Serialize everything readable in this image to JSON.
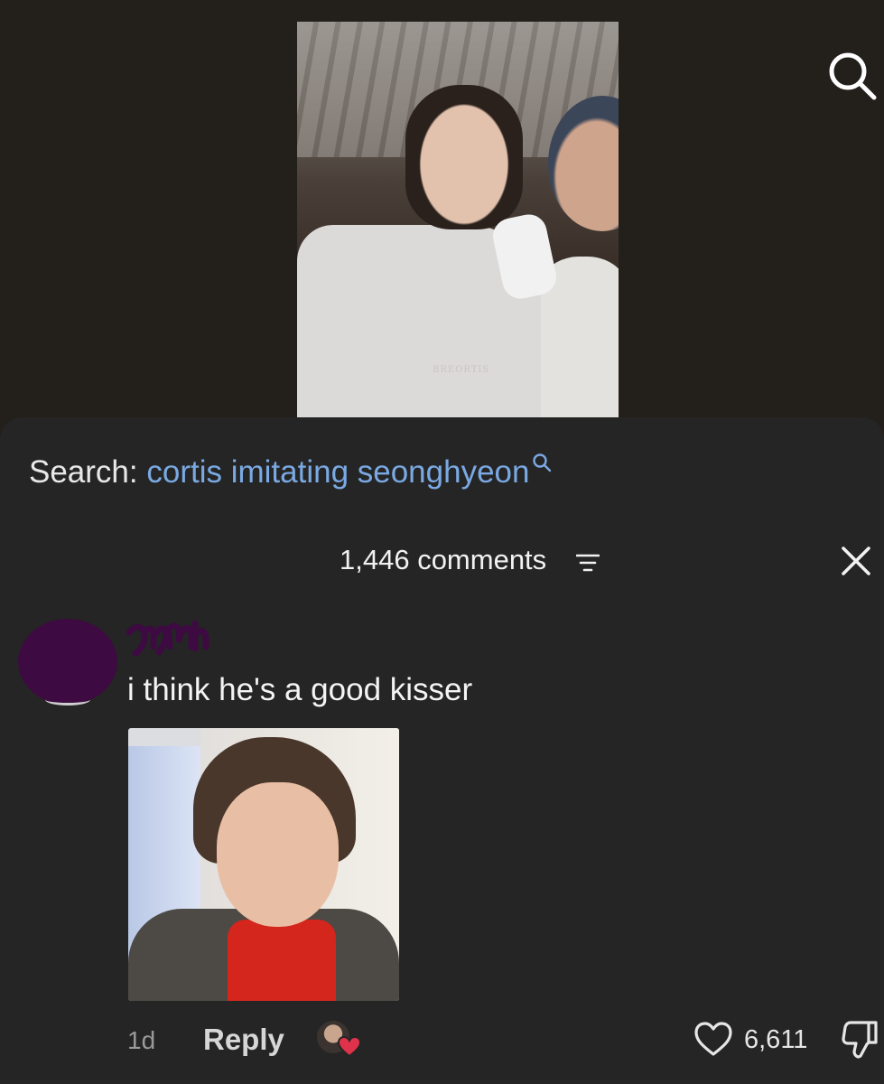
{
  "search": {
    "prefix": "Search:",
    "query": "cortis imitating seonghyeon",
    "query_color": "#7aa9e3"
  },
  "video": {
    "watermark": "BREORTIS"
  },
  "comments_header": {
    "count_label": "1,446 comments"
  },
  "comment": {
    "username_scribble": "redacted",
    "text": "i think he's a good kisser",
    "time": "1d",
    "reply_label": "Reply",
    "likes": "6,611"
  },
  "icons": [
    "search-icon",
    "sort-icon",
    "close-icon",
    "heart-icon",
    "dislike-icon"
  ],
  "colors": {
    "background": "#231f1b",
    "sheet": "#252525",
    "link": "#7aa9e3",
    "avatar_redaction": "#3d0a41",
    "heart_badge": "#e0324a"
  }
}
